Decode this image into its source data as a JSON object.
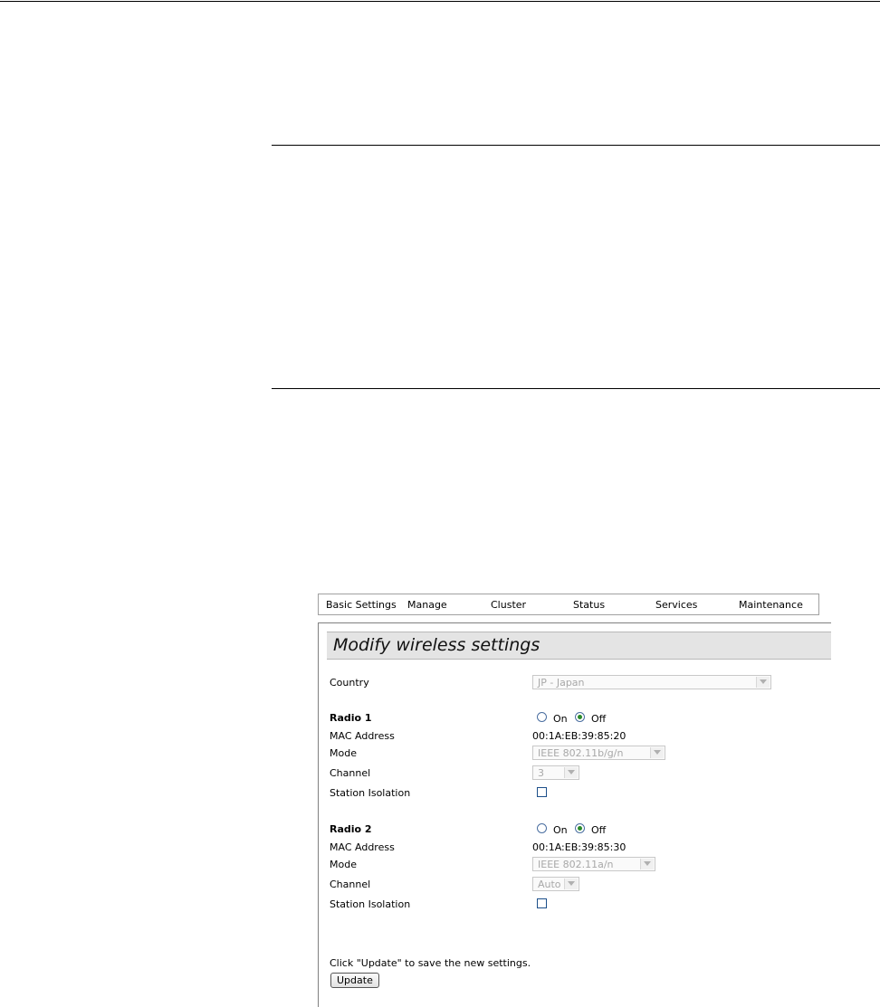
{
  "nav": {
    "items": [
      "Basic Settings",
      "Manage",
      "Cluster",
      "Status",
      "Services",
      "Maintenance"
    ]
  },
  "panel": {
    "title": "Modify wireless settings",
    "country_label": "Country",
    "country_value": "JP - Japan",
    "radios": [
      {
        "heading": "Radio 1",
        "on_label": "On",
        "off_label": "Off",
        "selected": "Off",
        "mac_label": "MAC Address",
        "mac_value": "00:1A:EB:39:85:20",
        "mode_label": "Mode",
        "mode_value": "IEEE 802.11b/g/n",
        "channel_label": "Channel",
        "channel_value": "3",
        "isolation_label": "Station Isolation",
        "isolation_checked": false
      },
      {
        "heading": "Radio 2",
        "on_label": "On",
        "off_label": "Off",
        "selected": "Off",
        "mac_label": "MAC Address",
        "mac_value": "00:1A:EB:39:85:30",
        "mode_label": "Mode",
        "mode_value": "IEEE 802.11a/n",
        "channel_label": "Channel",
        "channel_value": "Auto",
        "isolation_label": "Station Isolation",
        "isolation_checked": false
      }
    ],
    "hint": "Click \"Update\" to save the new settings.",
    "update_label": "Update"
  }
}
